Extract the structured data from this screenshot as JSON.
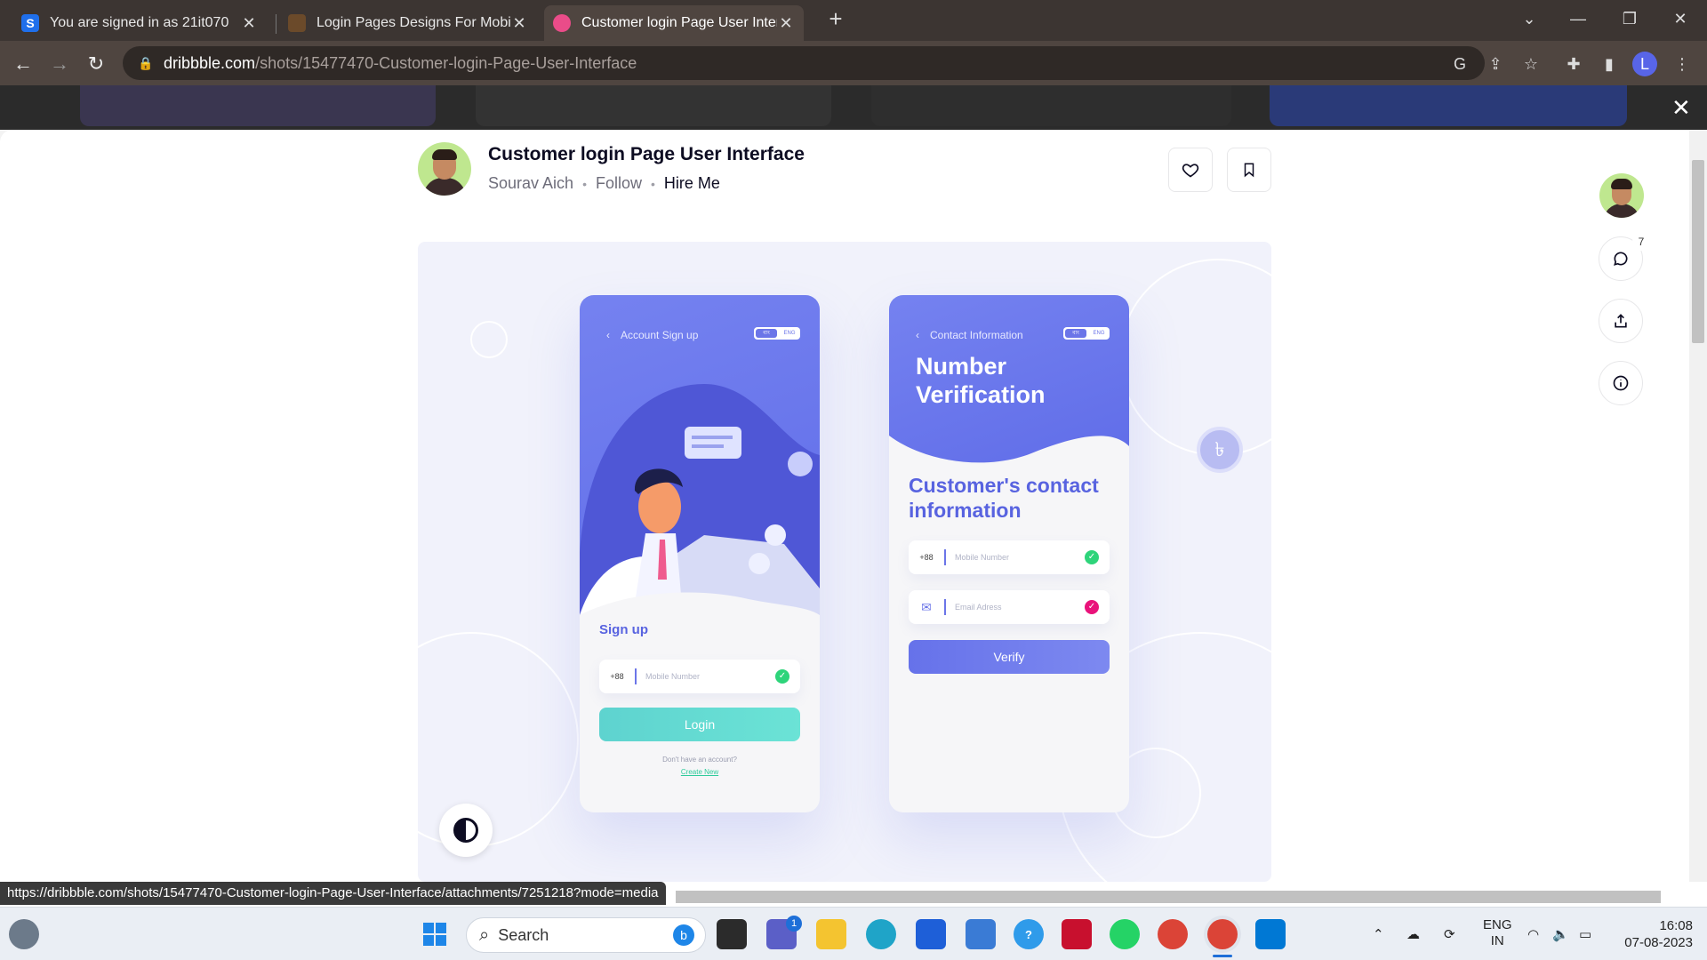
{
  "tabs": [
    {
      "title": "You are signed in as 21it070",
      "favicon": "S",
      "active": false
    },
    {
      "title": "Login Pages Designs For Mobile /",
      "favicon": "",
      "active": false
    },
    {
      "title": "Customer login Page User Interfa",
      "favicon": "",
      "active": true
    }
  ],
  "address": {
    "domain": "dribbble.com",
    "path": "/shots/15477470-Customer-login-Page-User-Interface"
  },
  "shot": {
    "title": "Customer login Page User Interface",
    "author": "Sourav Aich",
    "follow": "Follow",
    "hire": "Hire Me",
    "comment_count": "7"
  },
  "phone1": {
    "nav_title": "Account Sign up",
    "toggle_a": "বাং",
    "toggle_b": "ENG",
    "heading": "Sign up",
    "prefix": "+88",
    "mobile_placeholder": "Mobile Number",
    "login_label": "Login",
    "no_account": "Don't have an account?",
    "create_new": "Create New"
  },
  "phone2": {
    "nav_title": "Contact Information",
    "toggle_a": "বাং",
    "toggle_b": "ENG",
    "hero_line1": "Number",
    "hero_line2": "Verification",
    "subhead_line1": "Customer's contact",
    "subhead_line2": "information",
    "prefix": "+88",
    "mobile_placeholder": "Mobile Number",
    "email_placeholder": "Email Adress",
    "verify_label": "Verify"
  },
  "status_url": "https://dribbble.com/shots/15477470-Customer-login-Page-User-Interface/attachments/7251218?mode=media",
  "taskbar": {
    "search_label": "Search",
    "lang_line1": "ENG",
    "lang_line2": "IN",
    "time": "16:08",
    "date": "07-08-2023",
    "teams_badge": "1"
  },
  "colors": {
    "accent": "#6b75e8",
    "teal": "#5ed3cf",
    "pink": "#ea4c89"
  }
}
